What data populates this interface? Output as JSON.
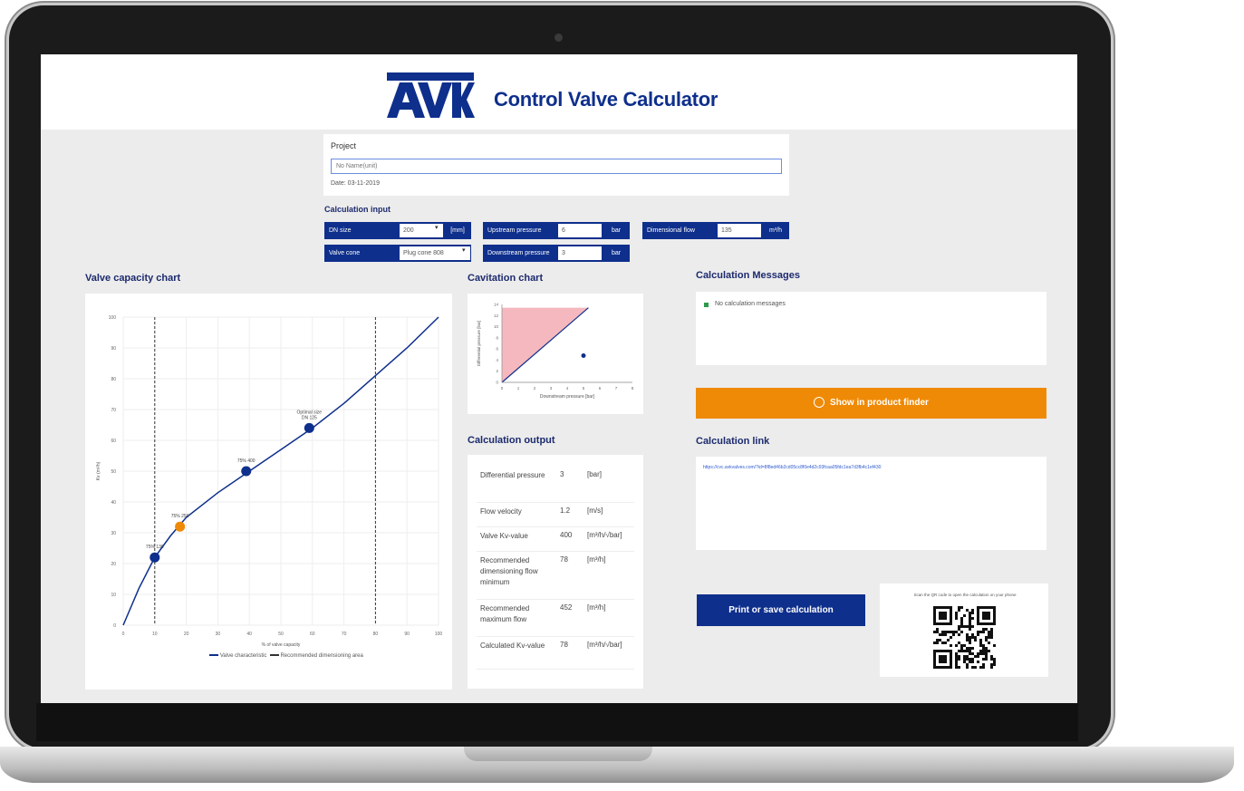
{
  "app": {
    "title": "Control Valve Calculator",
    "logo_text": "AVK"
  },
  "project": {
    "label": "Project",
    "name_placeholder": "No Name(unit)",
    "date": "Date: 03-11-2019"
  },
  "calc_input": {
    "title": "Calculation input",
    "dn_size": {
      "label": "DN size",
      "value": "200",
      "unit": "[mm]"
    },
    "valve_cone": {
      "label": "Valve cone",
      "value": "Plug cone 808"
    },
    "upstream": {
      "label": "Upstream pressure",
      "value": "6",
      "unit": "bar"
    },
    "downstream": {
      "label": "Downstream pressure",
      "value": "3",
      "unit": "bar"
    },
    "flow": {
      "label": "Dimensional flow",
      "value": "135",
      "unit": "m³/h"
    }
  },
  "valve_chart": {
    "title": "Valve capacity chart",
    "legend": [
      "Valve characteristic",
      "Recommended dimensioning area"
    ]
  },
  "chart_data": [
    {
      "type": "line",
      "title": "Valve capacity chart",
      "xlabel": "% of valve capacity",
      "ylabel": "Kv (m³/h)",
      "xlim": [
        0,
        100
      ],
      "ylim": [
        0,
        100
      ],
      "x_ticks": [
        0,
        10,
        20,
        30,
        40,
        50,
        60,
        70,
        80,
        90,
        100
      ],
      "y_ticks": [
        0,
        10,
        20,
        30,
        40,
        50,
        60,
        70,
        80,
        90,
        100
      ],
      "series": [
        {
          "name": "Valve characteristic",
          "x": [
            0,
            5,
            10,
            15,
            20,
            30,
            40,
            50,
            60,
            70,
            80,
            90,
            100
          ],
          "y": [
            0,
            12,
            22,
            29,
            35,
            43,
            50,
            57,
            64,
            72,
            81,
            90,
            100
          ]
        }
      ],
      "reference_lines_x": [
        10,
        80
      ],
      "points": [
        {
          "label": "75% 130",
          "x": 10,
          "y": 22,
          "color": "#0e2f8c"
        },
        {
          "label": "75% 250",
          "x": 18,
          "y": 32,
          "color": "#ef8a06"
        },
        {
          "label": "75% 400",
          "x": 39,
          "y": 50,
          "color": "#0e2f8c"
        },
        {
          "label": "Optimal size\nDN 125",
          "x": 59,
          "y": 64,
          "color": "#0e2f8c"
        }
      ],
      "grid": true
    },
    {
      "type": "scatter",
      "title": "Cavitation chart",
      "xlabel": "Downstream pressure [bar]",
      "ylabel": "Differential pressure [bar]",
      "xlim": [
        0,
        8
      ],
      "ylim": [
        0,
        14
      ],
      "x_ticks": [
        0,
        1,
        2,
        3,
        4,
        5,
        6,
        7,
        8
      ],
      "y_ticks": [
        0,
        2,
        4,
        6,
        8,
        10,
        12,
        14
      ],
      "cavitation_boundary": {
        "x": [
          0,
          5.3
        ],
        "y": [
          0,
          13.4
        ]
      },
      "point": {
        "x": 5,
        "y": 4.8
      }
    }
  ],
  "cav_chart": {
    "title": "Cavitation chart"
  },
  "calc_output": {
    "title": "Calculation output",
    "rows": [
      {
        "name": "Differential pressure",
        "value": "3",
        "unit": "[bar]"
      },
      {
        "name": "Flow velocity",
        "value": "1.2",
        "unit": "[m/s]"
      },
      {
        "name": "Valve Kv-value",
        "value": "400",
        "unit": "[m³/h/√bar]"
      },
      {
        "name": "Recommended dimensioning flow minimum",
        "value": "78",
        "unit": "[m³/h]"
      },
      {
        "name": "Recommended maximum flow",
        "value": "452",
        "unit": "[m³/h]"
      },
      {
        "name": "Calculated Kv-value",
        "value": "78",
        "unit": "[m³/h/√bar]"
      }
    ]
  },
  "messages": {
    "title": "Calculation Messages",
    "items": [
      "No calculation messages"
    ]
  },
  "product_finder": {
    "label": "Show in product finder"
  },
  "calc_link": {
    "title": "Calculation link",
    "url": "https://cvc.avkvalves.com/?id=8f8ed46b2cd05cc8f0e4d2c93fcaa05fdc1ea7d3fb4c1ef430"
  },
  "print": {
    "label": "Print or save calculation"
  },
  "qr": {
    "text": "Scan the QR code to open the calculation on your phone"
  }
}
